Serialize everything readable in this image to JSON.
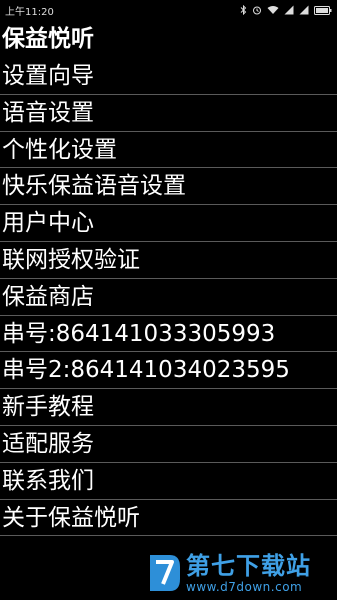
{
  "status_bar": {
    "time": "上午11:20",
    "icons": [
      "bluetooth-icon",
      "alarm-icon",
      "wifi-icon",
      "signal-icon",
      "signal-icon",
      "battery-icon"
    ]
  },
  "app": {
    "title": "保益悦听"
  },
  "menu": {
    "items": [
      "设置向导",
      "语音设置",
      "个性化设置",
      "快乐保益语音设置",
      "用户中心",
      "联网授权验证",
      "保益商店",
      "串号:864141033305993",
      "串号2:864141034023595",
      "新手教程",
      "适配服务",
      "联系我们",
      "关于保益悦听"
    ]
  },
  "watermark": {
    "name": "第七下载站",
    "url": "www.d7down.com"
  }
}
